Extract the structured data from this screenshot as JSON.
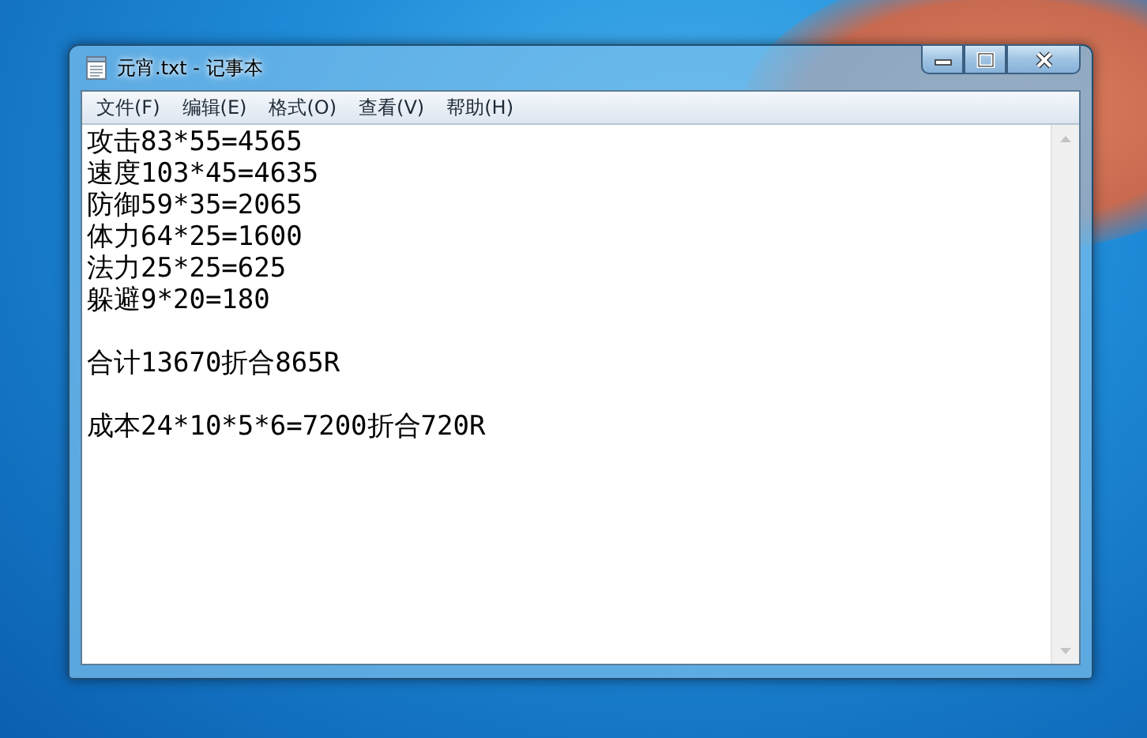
{
  "window": {
    "title": "元宵.txt - 记事本"
  },
  "menu": [
    "文件(F)",
    "编辑(E)",
    "格式(O)",
    "查看(V)",
    "帮助(H)"
  ],
  "document": {
    "paragraphs": [
      [
        "攻击83*55=4565",
        "速度103*45=4635",
        "防御59*35=2065",
        "体力64*25=1600",
        "法力25*25=625",
        "躲避9*20=180"
      ],
      [
        "合计13670折合865R"
      ],
      [
        "成本24*10*5*6=7200折合720R"
      ]
    ]
  }
}
